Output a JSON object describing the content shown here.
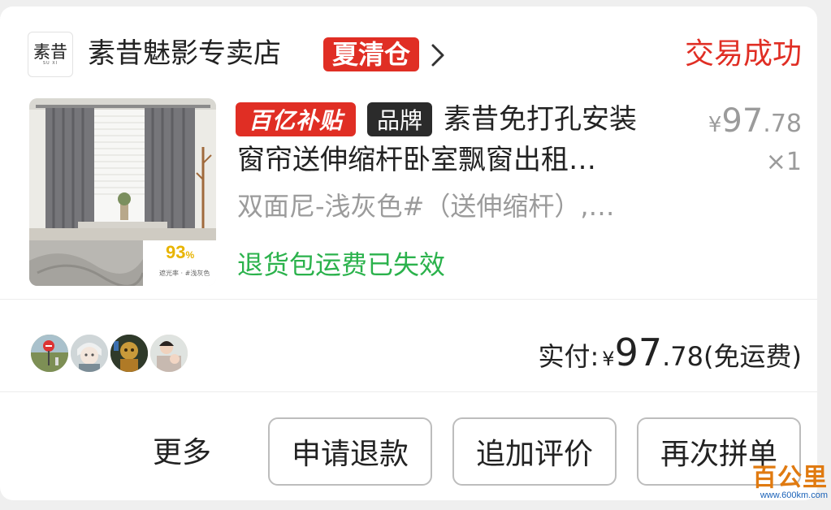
{
  "shop": {
    "logo_char": "素昔",
    "logo_sub": "SU XI",
    "name": "素昔魅影专卖店",
    "badge": "夏清仓",
    "status": "交易成功"
  },
  "product": {
    "badge_subsidy": "百亿补贴",
    "badge_brand": "品牌",
    "title_line1": "素昔免打孔安装",
    "title_line2": "窗帘送伸缩杆卧室飘窗出租…",
    "spec": "双面尼-浅灰色#（送伸缩杆）,…",
    "return_note": "退货包运费已失效",
    "price_currency": "¥",
    "price_int": "97",
    "price_dec": ".78",
    "quantity": "×1",
    "thumb_tag_value": "93",
    "thumb_tag_pct": "%",
    "thumb_tag_caption": "遮光率 · #浅灰色"
  },
  "payment": {
    "label": "实付:",
    "currency": "¥",
    "int": "97",
    "dec": ".78",
    "shipping": "(免运费)"
  },
  "actions": {
    "more": "更多",
    "refund": "申请退款",
    "add_review": "追加评价",
    "reorder": "再次拼单"
  },
  "watermark": {
    "main": "百公里",
    "url": "www.600km.com"
  },
  "colors": {
    "accent_red": "#e02e24",
    "success_green": "#2bb24c",
    "muted_gray": "#9b9b9b"
  }
}
